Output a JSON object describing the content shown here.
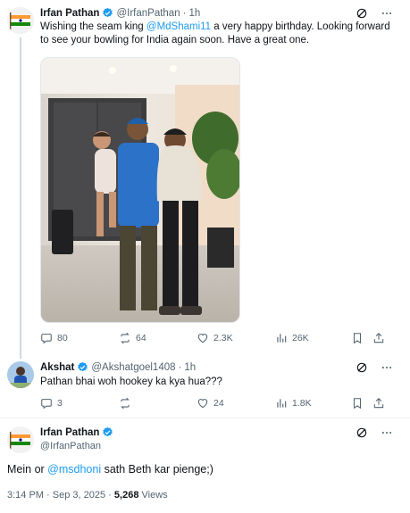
{
  "tweet1": {
    "author_name": "Irfan Pathan",
    "author_handle": "@IrfanPathan",
    "separator": "·",
    "time": "1h",
    "text_1": "Wishing the seam king ",
    "mention": "@MdShami11",
    "text_2": " a very happy birthday. Looking forward",
    "text_line2": "to see your bowling for India again soon. Have a great one.",
    "stats": {
      "replies": "80",
      "reposts": "64",
      "likes": "2.3K",
      "views": "26K"
    }
  },
  "reply": {
    "author_name": "Akshat",
    "author_handle": "@Akshatgoel1408",
    "separator": "·",
    "time": "1h",
    "text": "Pathan bhai woh hookey ka kya hua???",
    "stats": {
      "replies": "3",
      "reposts": "",
      "likes": "24",
      "views": "1.8K"
    }
  },
  "main": {
    "author_name": "Irfan Pathan",
    "author_handle": "@IrfanPathan",
    "text_1": "Mein or ",
    "mention": "@msdhoni",
    "text_2": " sath Beth kar pienge;)",
    "time": "3:14 PM",
    "date": "Sep 3, 2025",
    "separator": "·",
    "views_count": "5,268",
    "views_label": "Views"
  },
  "colors": {
    "accent": "#1d9bf0",
    "text": "#0f1419",
    "muted": "#536471",
    "line": "#cfd9de"
  },
  "icons": [
    "verified-badge-icon",
    "grok-icon",
    "more-icon",
    "reply-icon",
    "repost-icon",
    "like-icon",
    "views-icon",
    "bookmark-icon",
    "share-icon"
  ]
}
